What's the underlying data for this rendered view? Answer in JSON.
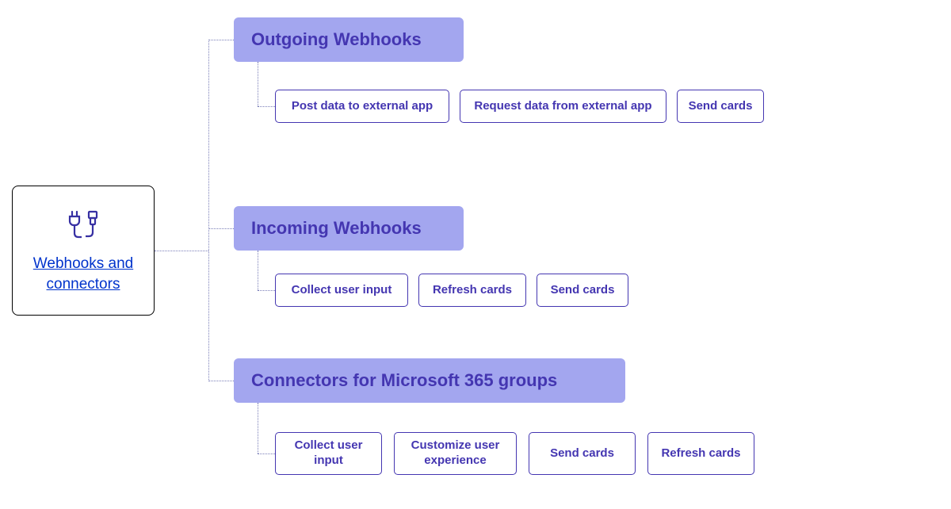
{
  "root": {
    "label": "Webhooks and connectors"
  },
  "branches": [
    {
      "title": "Outgoing Webhooks",
      "features": [
        "Post data to external app",
        "Request data from external app",
        "Send cards"
      ]
    },
    {
      "title": "Incoming Webhooks",
      "features": [
        "Collect user input",
        "Refresh cards",
        "Send cards"
      ]
    },
    {
      "title": "Connectors for Microsoft 365 groups",
      "features": [
        "Collect user input",
        "Customize user experience",
        "Send cards",
        "Refresh cards"
      ]
    }
  ]
}
